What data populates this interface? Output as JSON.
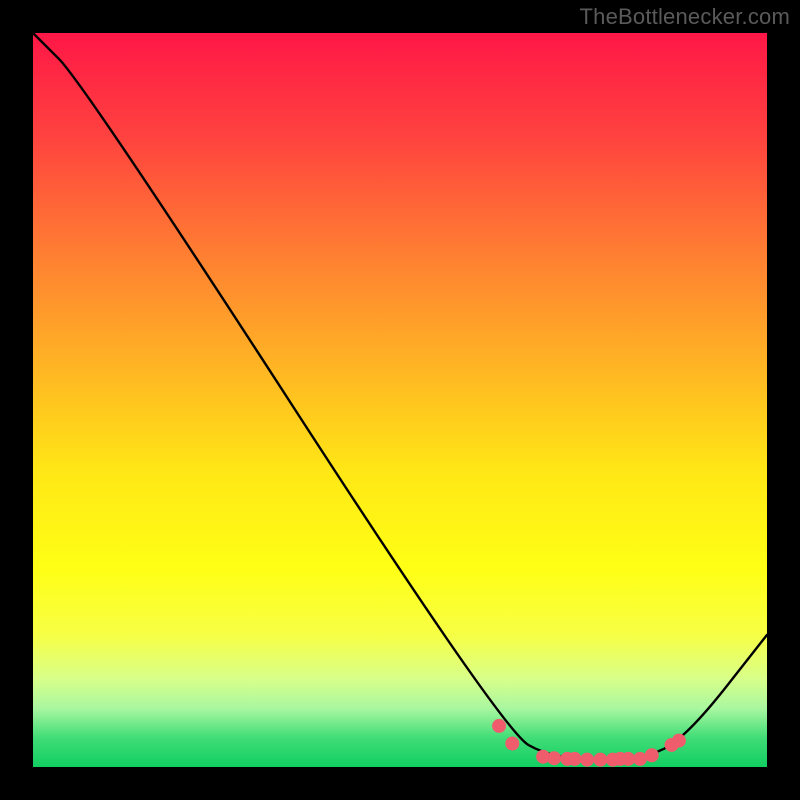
{
  "attribution": "TheBottlenecker.com",
  "chart_data": {
    "type": "line",
    "title": "",
    "xlabel": "",
    "ylabel": "",
    "xlim": [
      0,
      100
    ],
    "ylim": [
      0,
      100
    ],
    "grid": false,
    "series": [
      {
        "name": "curve",
        "color": "#000000",
        "points": [
          {
            "x": 0,
            "y": 100
          },
          {
            "x": 7,
            "y": 93
          },
          {
            "x": 64,
            "y": 5
          },
          {
            "x": 71,
            "y": 1
          },
          {
            "x": 83,
            "y": 1
          },
          {
            "x": 89,
            "y": 4
          },
          {
            "x": 100,
            "y": 18
          }
        ]
      }
    ],
    "markers": {
      "color": "#ef5d6d",
      "radius_px": 7,
      "points": [
        {
          "x": 63.5,
          "y": 5.6
        },
        {
          "x": 65.3,
          "y": 3.2
        },
        {
          "x": 69.5,
          "y": 1.4
        },
        {
          "x": 71.0,
          "y": 1.2
        },
        {
          "x": 72.8,
          "y": 1.1
        },
        {
          "x": 73.8,
          "y": 1.1
        },
        {
          "x": 75.5,
          "y": 1.0
        },
        {
          "x": 77.3,
          "y": 1.0
        },
        {
          "x": 79.0,
          "y": 1.0
        },
        {
          "x": 80.0,
          "y": 1.1
        },
        {
          "x": 81.1,
          "y": 1.1
        },
        {
          "x": 82.7,
          "y": 1.1
        },
        {
          "x": 84.3,
          "y": 1.6
        },
        {
          "x": 87.0,
          "y": 3.0
        },
        {
          "x": 88.0,
          "y": 3.6
        }
      ]
    },
    "background_gradient": {
      "stops": [
        {
          "pos": 0.0,
          "color": "#ff1747"
        },
        {
          "pos": 0.14,
          "color": "#ff423f"
        },
        {
          "pos": 0.3,
          "color": "#ff7e32"
        },
        {
          "pos": 0.45,
          "color": "#ffb324"
        },
        {
          "pos": 0.6,
          "color": "#ffe815"
        },
        {
          "pos": 0.73,
          "color": "#ffff15"
        },
        {
          "pos": 0.82,
          "color": "#f7ff45"
        },
        {
          "pos": 0.88,
          "color": "#d8ff8a"
        },
        {
          "pos": 0.92,
          "color": "#a9f7a0"
        },
        {
          "pos": 0.96,
          "color": "#41dd77"
        },
        {
          "pos": 1.0,
          "color": "#11cf62"
        }
      ]
    }
  }
}
